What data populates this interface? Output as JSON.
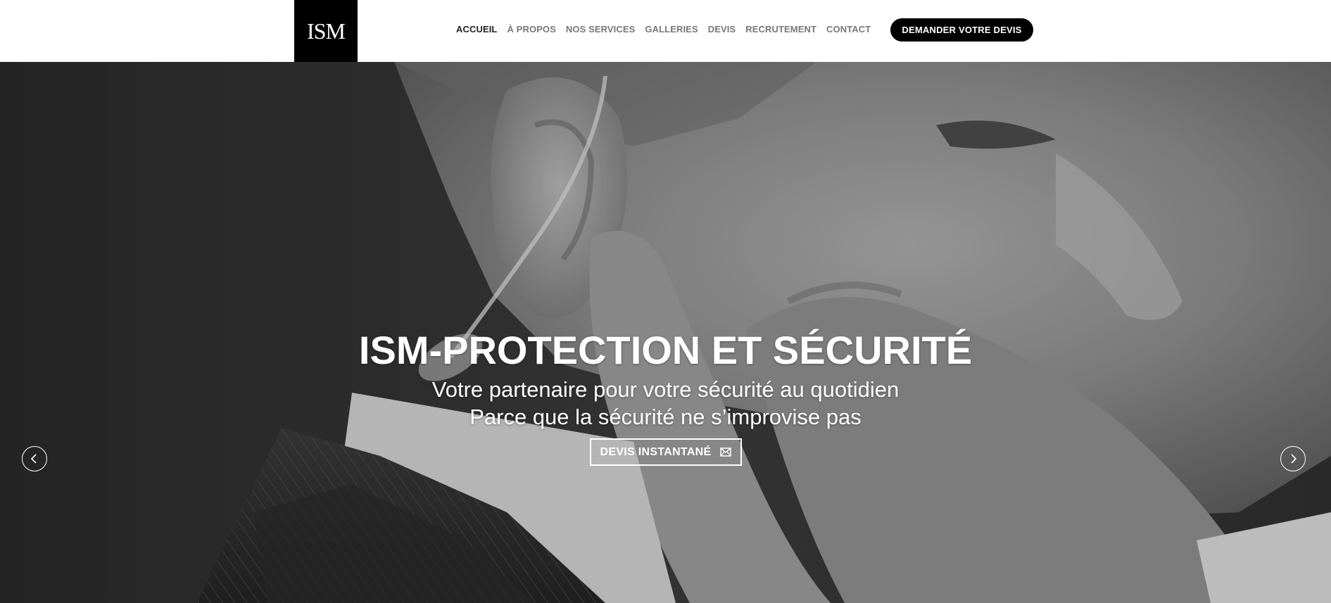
{
  "brand": {
    "logo_text": "ISM"
  },
  "nav": {
    "items": [
      {
        "label": "ACCUEIL",
        "active": true
      },
      {
        "label": "À PROPOS",
        "active": false
      },
      {
        "label": "NOS SERVICES",
        "active": false
      },
      {
        "label": "GALLERIES",
        "active": false
      },
      {
        "label": "DEVIS",
        "active": false
      },
      {
        "label": "RECRUTEMENT",
        "active": false
      },
      {
        "label": "CONTACT",
        "active": false
      }
    ]
  },
  "header": {
    "cta_label": "DEMANDER VOTRE DEVIS"
  },
  "hero": {
    "title": "ISM-PROTECTION ET SÉCURITÉ",
    "subtitle_1": "Votre partenaire pour votre sécurité au quotidien",
    "subtitle_2": "Parce que la sécurité ne s’improvise pas",
    "button_label": "DEVIS INSTANTANÉ",
    "button_icon": "envelope-icon",
    "prev_icon": "chevron-left-icon",
    "next_icon": "chevron-right-icon"
  },
  "colors": {
    "header_bg": "#ffffff",
    "logo_bg": "#000000",
    "nav_text": "#777777",
    "nav_active": "#222222",
    "cta_bg": "#000000",
    "hero_text": "#ffffff"
  }
}
